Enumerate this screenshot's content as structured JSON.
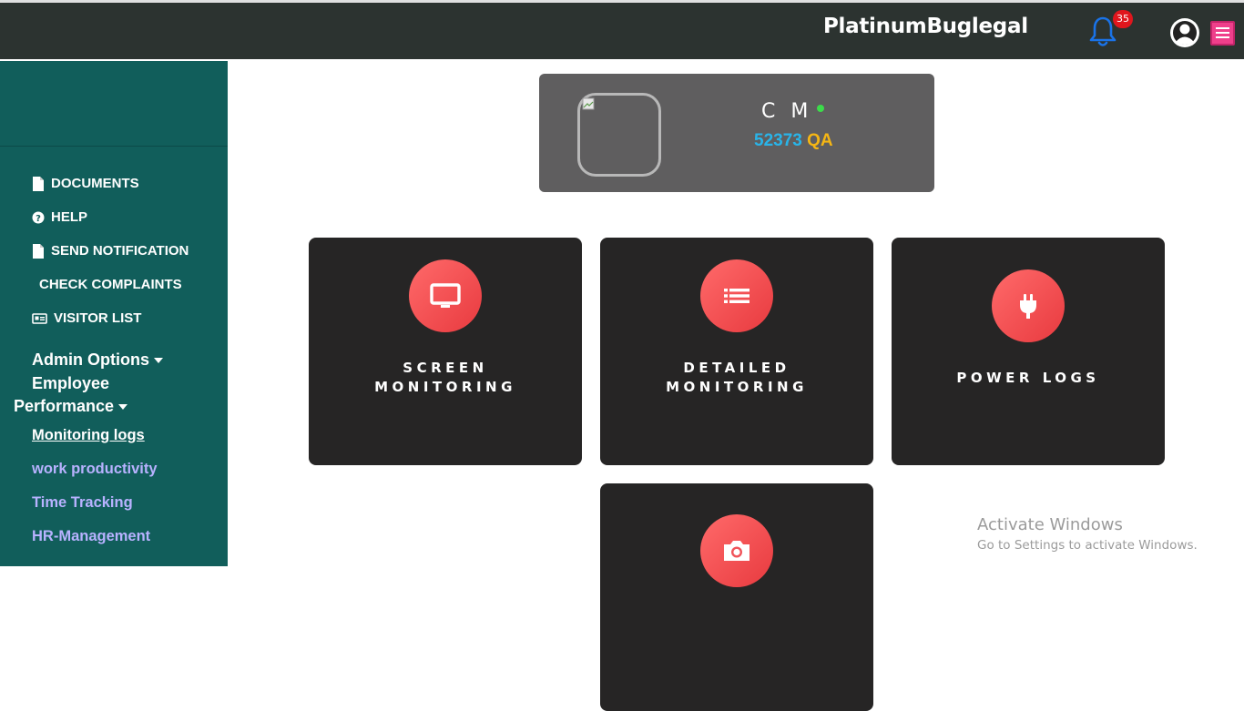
{
  "header": {
    "brand": "PlatinumBuglegal",
    "notification_count": "35",
    "icons": [
      "bell-icon",
      "user-circle-icon",
      "hamburger-menu-icon"
    ],
    "colors": {
      "bar": "#2c3330",
      "bell": "#1a73e8",
      "badge": "#e0161d",
      "menu": "#ef3f8b"
    }
  },
  "sidebar": {
    "bg": "#115e5b",
    "items": [
      {
        "label": "DOCUMENTS",
        "icon": "file-icon"
      },
      {
        "label": "HELP",
        "icon": "question-circle-icon"
      },
      {
        "label": "SEND NOTIFICATION",
        "icon": "file-icon"
      },
      {
        "label": "CHECK COMPLAINTS",
        "icon": ""
      },
      {
        "label": "VISITOR LIST",
        "icon": "id-card-icon"
      }
    ],
    "admin_options": "Admin Options",
    "employee_performance_1": "Employee",
    "employee_performance_2": "Performance",
    "links": [
      {
        "label": "Monitoring logs"
      },
      {
        "label": "work productivity"
      },
      {
        "label": "Time Tracking"
      },
      {
        "label": "HR-Management"
      }
    ]
  },
  "profile": {
    "name": "C M",
    "status": "online",
    "employee_id": "52373",
    "department": "QA"
  },
  "tiles": [
    {
      "label_line1": "SCREEN",
      "label_line2": "MONITORING",
      "icon": "monitor-icon"
    },
    {
      "label_line1": "DETAILED",
      "label_line2": "MONITORING",
      "icon": "list-icon"
    },
    {
      "label_line1": "POWER LOGS",
      "label_line2": "",
      "icon": "plug-icon"
    },
    {
      "label_line1": "",
      "label_line2": "",
      "icon": "camera-icon"
    }
  ],
  "watermark": {
    "line1": "Activate Windows",
    "line2": "Go to Settings to activate Windows."
  }
}
